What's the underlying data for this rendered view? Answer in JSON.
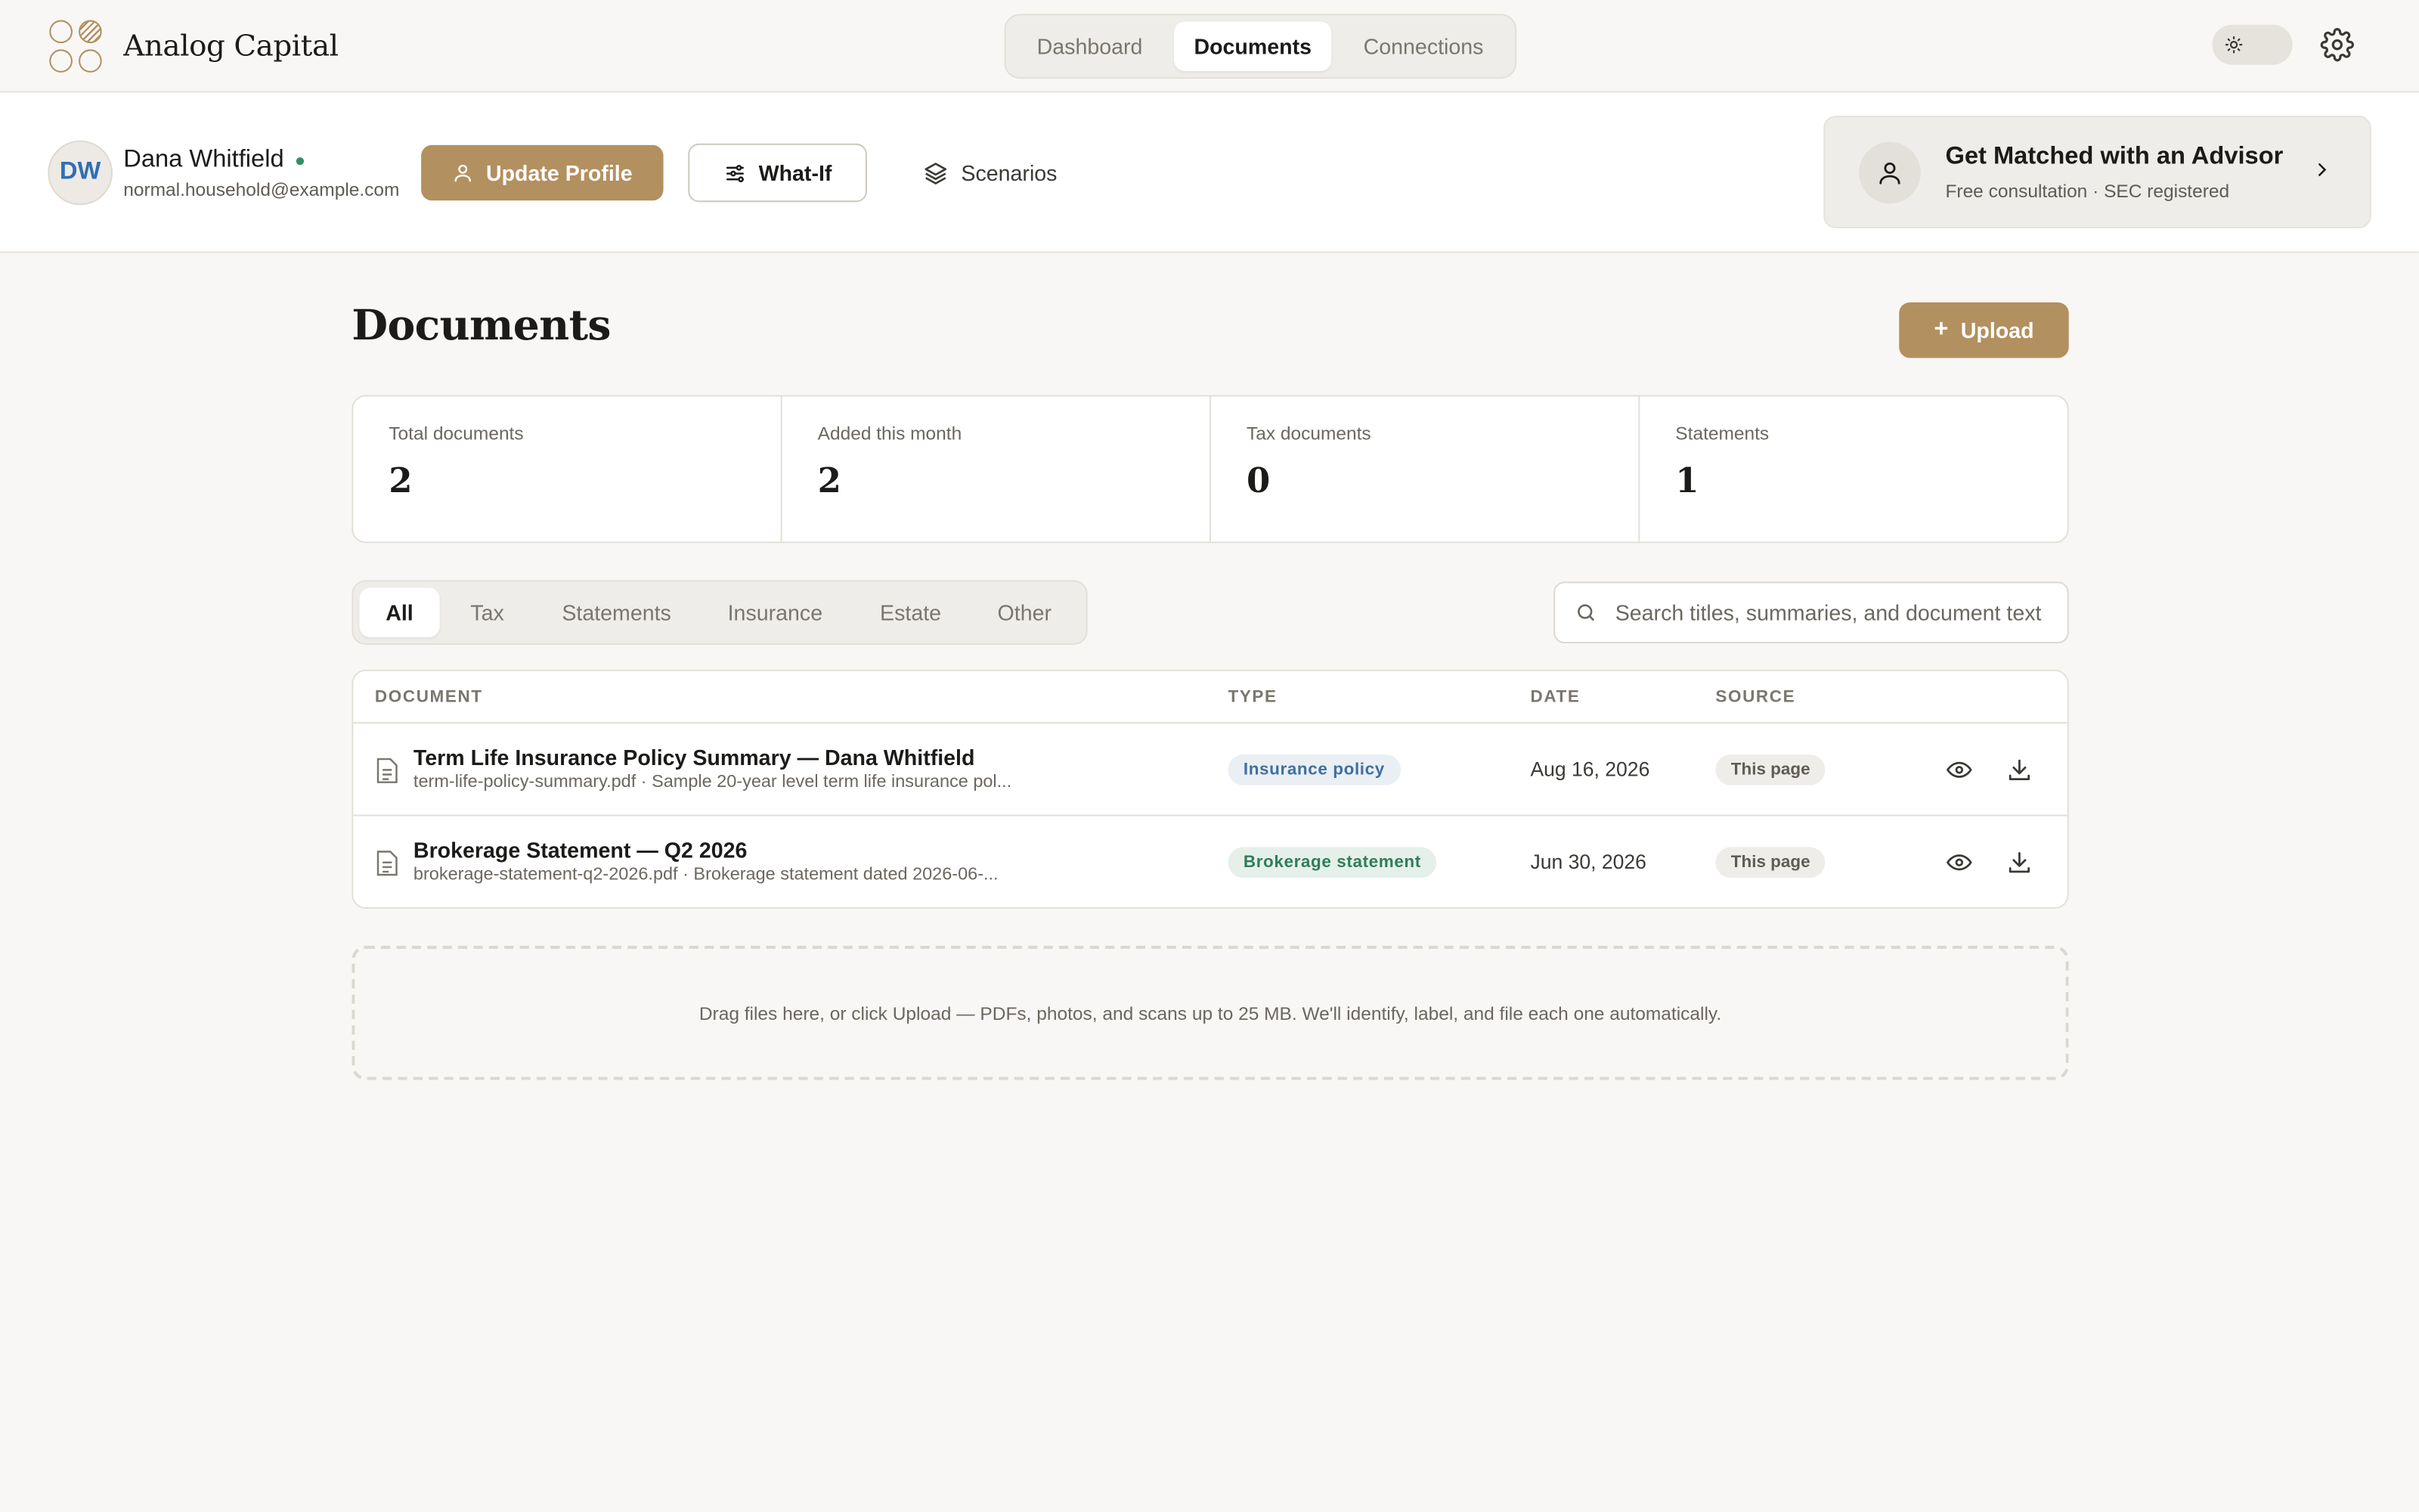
{
  "brand": {
    "name": "Analog Capital"
  },
  "nav": {
    "tabs": [
      "Dashboard",
      "Documents",
      "Connections"
    ],
    "active": "Documents"
  },
  "profile": {
    "initials": "DW",
    "name": "Dana Whitfield",
    "email": "normal.household@example.com",
    "update_label": "Update Profile",
    "whatif_label": "What-If",
    "scenarios_label": "Scenarios"
  },
  "advisor": {
    "title": "Get Matched with an Advisor",
    "subtitle": "Free consultation · SEC registered"
  },
  "main": {
    "title": "Documents",
    "upload_label": "Upload",
    "stats": [
      {
        "label": "Total documents",
        "value": "2"
      },
      {
        "label": "Added this month",
        "value": "2"
      },
      {
        "label": "Tax documents",
        "value": "0"
      },
      {
        "label": "Statements",
        "value": "1"
      }
    ],
    "filters": [
      "All",
      "Tax",
      "Statements",
      "Insurance",
      "Estate",
      "Other"
    ],
    "search_placeholder": "Search titles, summaries, and document text",
    "columns": [
      "DOCUMENT",
      "TYPE",
      "DATE",
      "SOURCE"
    ],
    "rows": [
      {
        "title": "Term Life Insurance Policy Summary — Dana Whitfield",
        "subtitle": "term-life-policy-summary.pdf · Sample 20-year level term life insurance pol...",
        "type": "Insurance policy",
        "date": "Aug 16, 2026",
        "source": "This page"
      },
      {
        "title": "Brokerage Statement — Q2 2026",
        "subtitle": "brokerage-statement-q2-2026.pdf · Brokerage statement dated 2026-06-...",
        "type": "Brokerage statement",
        "date": "Jun 30, 2026",
        "source": "This page"
      }
    ],
    "dropzone_text": "Drag files here, or click Upload — PDFs, photos, and scans up to 25 MB. We'll identify, label, and file each one automatically."
  },
  "colors": {
    "accent": "#b3905f",
    "background": "#f8f7f5",
    "online": "#2f8f63"
  }
}
